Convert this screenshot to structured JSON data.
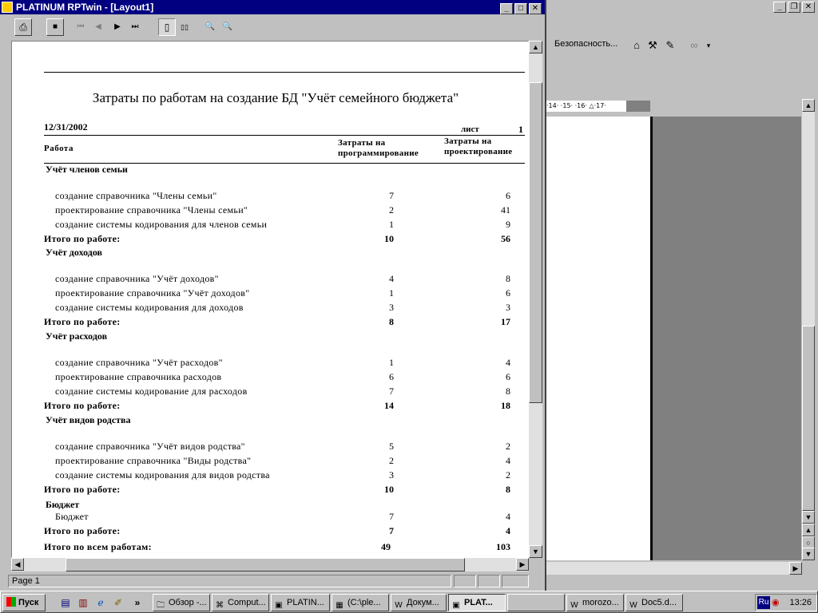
{
  "word": {
    "toolbar_security": "Безопасность...",
    "ruler_text": "·14· ·15· ·16· △·17·",
    "ctrl_min": "_",
    "ctrl_restore": "❐",
    "ctrl_close": "✕",
    "icons": [
      "toolbox-icon",
      "tools-icon",
      "design-icon",
      "link-icon"
    ]
  },
  "window": {
    "title": "PLATINUM RPTwin - [Layout1]",
    "ctrl_min": "_",
    "ctrl_max": "□",
    "ctrl_close": "✕"
  },
  "toolbar": {
    "print": "⎙",
    "stop": "■",
    "first": "⏮",
    "prev": "◀",
    "next": "▶",
    "last": "⏭",
    "single_page": "▯",
    "two_pages": "▯▯",
    "zoom_in": "🔍",
    "zoom_out": "🔍"
  },
  "report": {
    "title": "Затраты по работам на создание БД \"Учёт семейного бюджета\"",
    "date": "12/31/2002",
    "sheet_label": "лист",
    "sheet_num": "1",
    "col_work": "Работа",
    "col_prog_1": "Затраты на",
    "col_prog_2": "программирование",
    "col_design_1": "Затраты на",
    "col_design_2": "проектирование",
    "groups": [
      {
        "name": "Учёт членов семьи",
        "items": [
          {
            "label": "создание справочника \"Члены семьи\"",
            "prog": "7",
            "design": "6"
          },
          {
            "label": "проектирование справочника \"Члены семьи\"",
            "prog": "2",
            "design": "41"
          },
          {
            "label": "создание системы кодирования для членов семьи",
            "prog": "1",
            "design": "9"
          }
        ],
        "total_label": "Итого по работе:",
        "total_prog": "10",
        "total_design": "56"
      },
      {
        "name": "Учёт доходов",
        "items": [
          {
            "label": "создание справочника \"Учёт доходов\"",
            "prog": "4",
            "design": "8"
          },
          {
            "label": "проектирование справочника \"Учёт доходов\"",
            "prog": "1",
            "design": "6"
          },
          {
            "label": "создание системы кодирования для доходов",
            "prog": "3",
            "design": "3"
          }
        ],
        "total_label": "Итого по работе:",
        "total_prog": "8",
        "total_design": "17"
      },
      {
        "name": "Учёт расходов",
        "items": [
          {
            "label": "создание справочника \"Учёт расходов\"",
            "prog": "1",
            "design": "4"
          },
          {
            "label": "проектирование справочника расходов",
            "prog": "6",
            "design": "6"
          },
          {
            "label": "создание системы кодирование для расходов",
            "prog": "7",
            "design": "8"
          }
        ],
        "total_label": "Итого по работе:",
        "total_prog": "14",
        "total_design": "18"
      },
      {
        "name": "Учёт видов родства",
        "items": [
          {
            "label": "создание справочника \"Учёт видов родства\"",
            "prog": "5",
            "design": "2"
          },
          {
            "label": "проектирование справочника \"Виды родства\"",
            "prog": "2",
            "design": "4"
          },
          {
            "label": "создание системы кодирования для видов родства",
            "prog": "3",
            "design": "2"
          }
        ],
        "total_label": "Итого по работе:",
        "total_prog": "10",
        "total_design": "8"
      },
      {
        "name": "Бюджет",
        "items": [
          {
            "label": "Бюджет",
            "prog": "7",
            "design": "4"
          }
        ],
        "total_label": "Итого по работе:",
        "total_prog": "7",
        "total_design": "4"
      }
    ],
    "grand_total_label": "Итого по всем работам:",
    "grand_total_prog": "49",
    "grand_total_design": "103"
  },
  "status": {
    "page": "Page 1"
  },
  "taskbar": {
    "start": "Пуск",
    "quicklaunch_arrow": "»",
    "tasks": [
      {
        "label": "Обзор -...",
        "icon": "folder-search-icon"
      },
      {
        "label": "Comput...",
        "icon": "computer-icon"
      },
      {
        "label": "PLATIN...",
        "icon": "platinum-app-icon"
      },
      {
        "label": "(C:\\ple...",
        "icon": "folder-icon"
      },
      {
        "label": "Докум...",
        "icon": "word-doc-icon"
      },
      {
        "label": "PLAT...",
        "icon": "platinum-app-icon"
      },
      {
        "label": "",
        "icon": ""
      },
      {
        "label": "morozo...",
        "icon": "word-doc-icon"
      },
      {
        "label": "Doc5.d...",
        "icon": "word-doc-icon"
      }
    ],
    "lang": "Ru",
    "clock": "13:26"
  }
}
